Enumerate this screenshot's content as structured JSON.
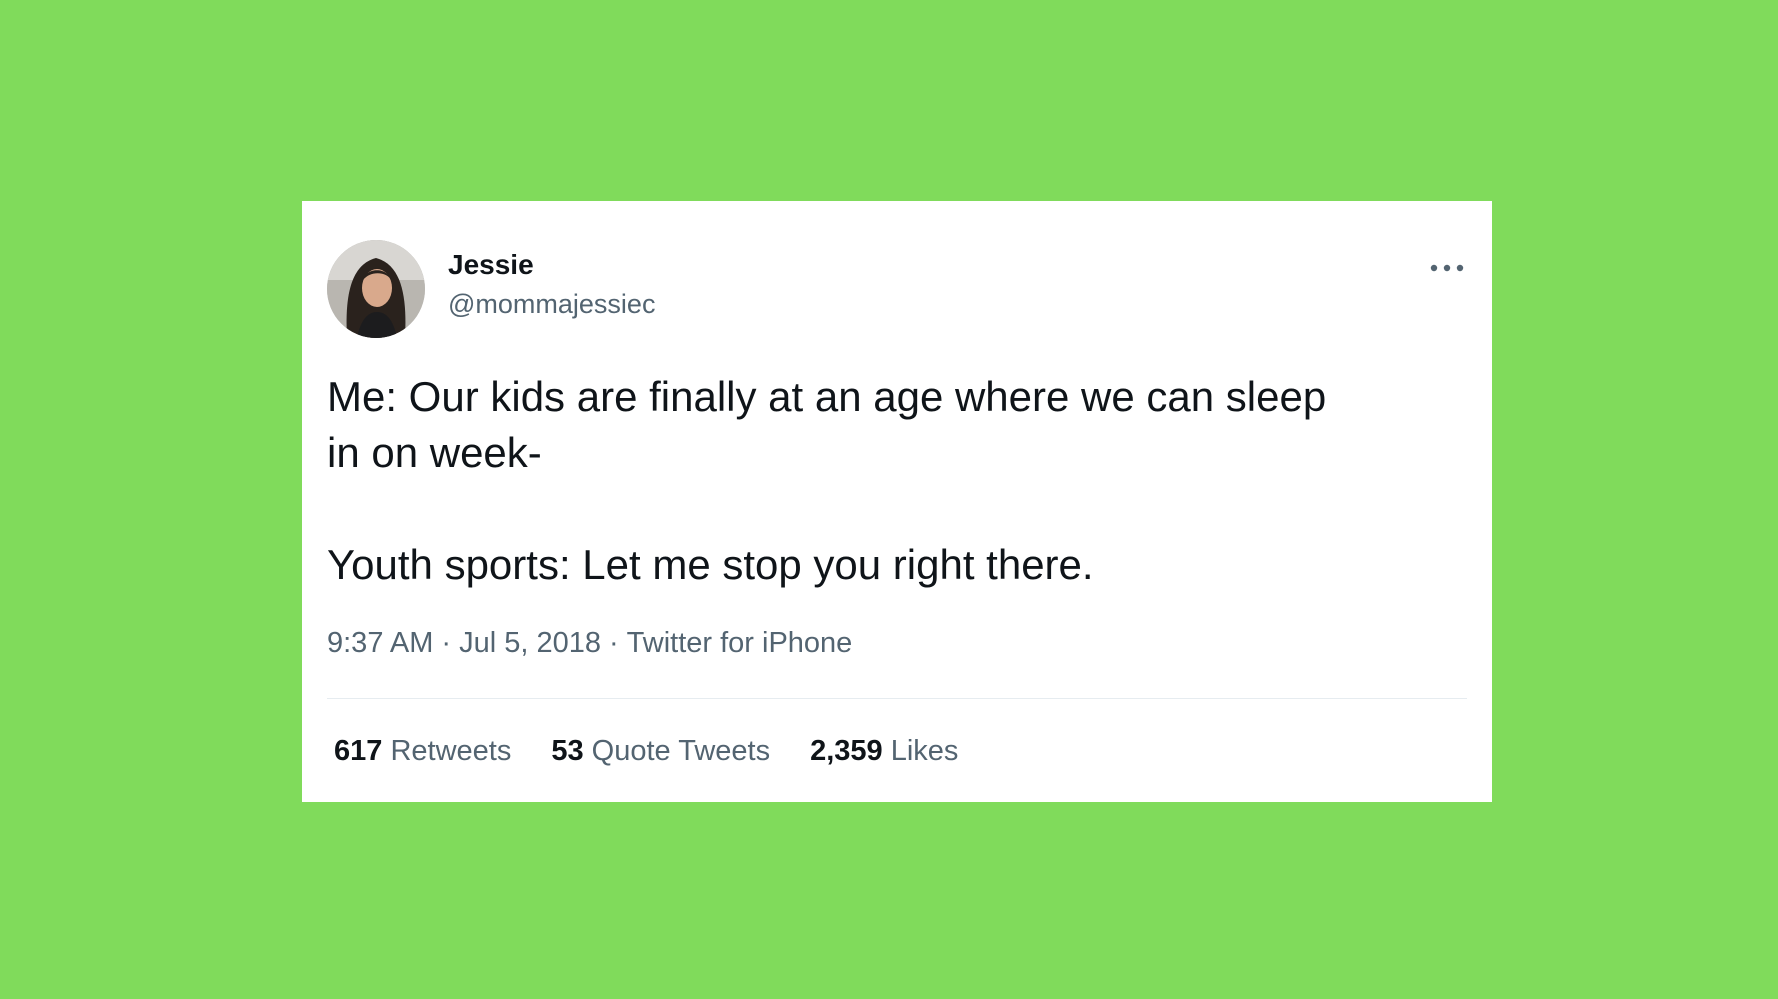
{
  "tweet": {
    "author": {
      "display_name": "Jessie",
      "handle": "@mommajessiec",
      "avatar_icon": "profile-photo"
    },
    "more_icon": "more-options-icon",
    "text": "Me: Our kids are finally at an age where we can sleep\nin on week-\n\nYouth sports: Let me stop you right there.",
    "time": "9:37 AM",
    "date": "Jul 5, 2018",
    "separator": "·",
    "source": "Twitter for iPhone",
    "stats": {
      "retweets_count": "617",
      "retweets_label": "Retweets",
      "quote_tweets_count": "53",
      "quote_tweets_label": "Quote Tweets",
      "likes_count": "2,359",
      "likes_label": "Likes"
    }
  },
  "colors": {
    "background": "#80db5b",
    "card": "#ffffff",
    "text_primary": "#0f1419",
    "text_secondary": "#536471"
  }
}
